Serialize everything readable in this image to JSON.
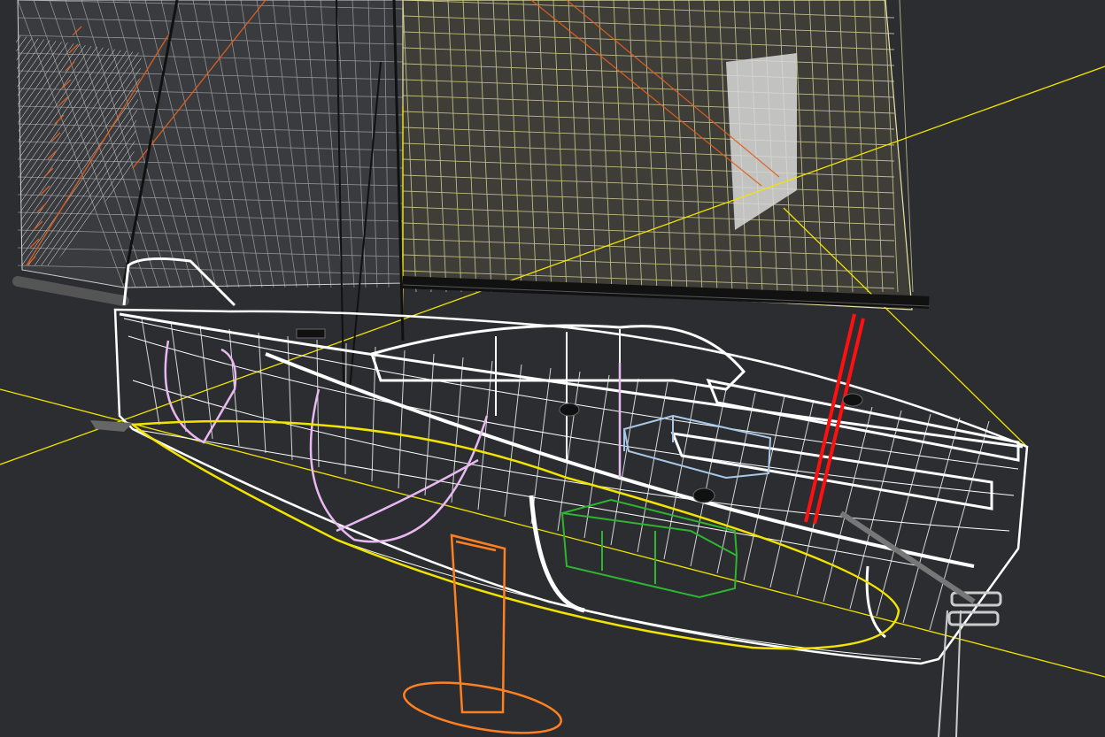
{
  "colors": {
    "background": "#2b2d31",
    "hull": "#ffffff",
    "sail_mesh_white": "#e8e8e8",
    "sail_mesh_yellow": "#e8e4a0",
    "sail_spreader_orange": "#e0601e",
    "guide_lines": "#f2e400",
    "frames": "#e8b8f0",
    "keel": "#ff8020",
    "boom": "#111111",
    "vang": "#ff1010",
    "tank_green": "#2fb52f",
    "tank_blue": "#a8c8e8"
  },
  "scene": {
    "type": "3D wireframe boat model",
    "elements": [
      "hull-wireframe",
      "mainsail-mesh",
      "headsail-mesh",
      "mast",
      "boom",
      "vang",
      "keel-fin",
      "keel-bulb",
      "internal-frames",
      "tanks",
      "winches",
      "bowsprit",
      "rudder",
      "reference-lines"
    ]
  }
}
